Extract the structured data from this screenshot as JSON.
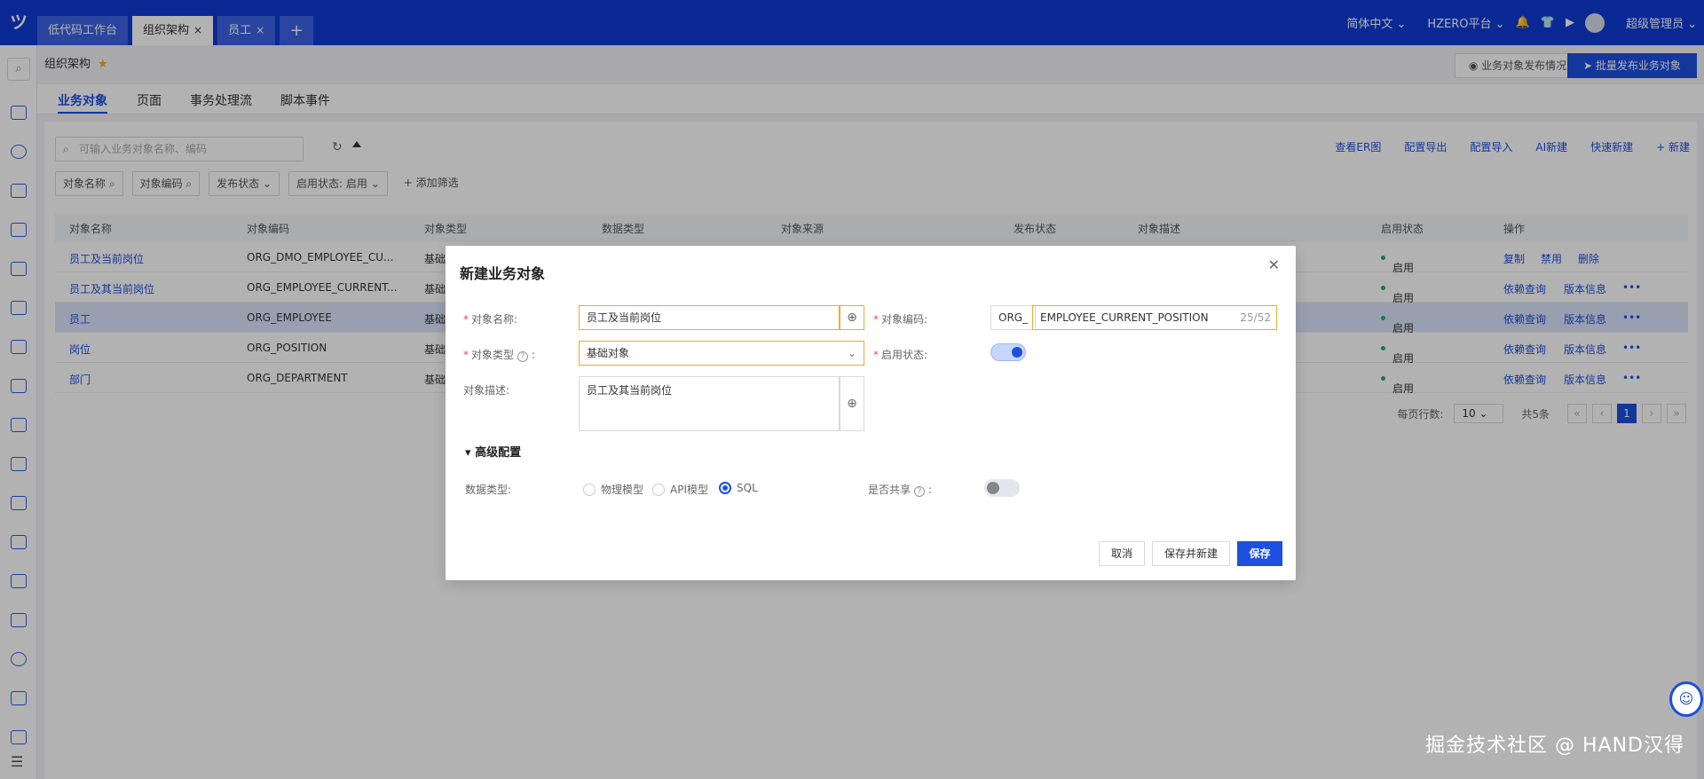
{
  "topbar": {
    "logo": "ツ",
    "tabs": [
      {
        "label": "低代码工作台",
        "closable": false
      },
      {
        "label": "组织架构",
        "closable": true,
        "active": true
      },
      {
        "label": "员工",
        "closable": true
      }
    ],
    "add_tab": "+",
    "close_glyph": "×",
    "language": "简体中文",
    "platform": "HZERO平台",
    "user": "超级管理员"
  },
  "page": {
    "title": "组织架构",
    "publish_status_btn": "业务对象发布情况",
    "batch_publish_btn": "批量发布业务对象",
    "tabs": [
      "业务对象",
      "页面",
      "事务处理流",
      "脚本事件"
    ]
  },
  "toolbar": {
    "search_placeholder": "可输入业务对象名称、编码",
    "actions": [
      "查看ER图",
      "配置导出",
      "配置导入",
      "AI新建",
      "快速新建",
      "+ 新建"
    ]
  },
  "filters": [
    "对象名称",
    "对象编码",
    "发布状态",
    "启用状态: 启用",
    "+ 添加筛选"
  ],
  "table": {
    "headers": [
      "对象名称",
      "对象编码",
      "对象类型",
      "数据类型",
      "对象来源",
      "发布状态",
      "对象描述",
      "启用状态",
      "操作"
    ],
    "rows": [
      {
        "name": "员工及当前岗位",
        "code": "ORG_DMO_EMPLOYEE_CU...",
        "type": "基础",
        "status": "启用",
        "ops": [
          "复制",
          "禁用",
          "删除"
        ]
      },
      {
        "name": "员工及其当前岗位",
        "code": "ORG_EMPLOYEE_CURRENT...",
        "type": "基础",
        "status": "启用",
        "ops": [
          "依赖查询",
          "版本信息",
          "•••"
        ]
      },
      {
        "name": "员工",
        "code": "ORG_EMPLOYEE",
        "type": "基础",
        "status": "启用",
        "ops": [
          "依赖查询",
          "版本信息",
          "•••"
        ]
      },
      {
        "name": "岗位",
        "code": "ORG_POSITION",
        "type": "基础",
        "status": "启用",
        "ops": [
          "依赖查询",
          "版本信息",
          "•••"
        ]
      },
      {
        "name": "部门",
        "code": "ORG_DEPARTMENT",
        "type": "基础",
        "status": "启用",
        "ops": [
          "依赖查询",
          "版本信息",
          "•••"
        ]
      }
    ]
  },
  "pager": {
    "per_page_label": "每页行数:",
    "per_page": "10",
    "total": "共5条",
    "current": "1"
  },
  "modal": {
    "title": "新建业务对象",
    "name_label": "对象名称:",
    "name_value": "员工及当前岗位",
    "code_label": "对象编码:",
    "code_prefix": "ORG_",
    "code_value": "EMPLOYEE_CURRENT_POSITION",
    "code_count": "25/52",
    "type_label": "对象类型",
    "type_value": "基础对象",
    "enable_label": "启用状态:",
    "desc_label": "对象描述:",
    "desc_value": "员工及其当前岗位",
    "advanced_label": "高级配置",
    "datatype_label": "数据类型:",
    "datatype_options": [
      "物理模型",
      "API模型",
      "SQL"
    ],
    "datatype_selected": "SQL",
    "shared_label": "是否共享",
    "cancel": "取消",
    "save_new": "保存并新建",
    "save": "保存"
  },
  "watermark": "掘金技术社区 @ HAND汉得"
}
